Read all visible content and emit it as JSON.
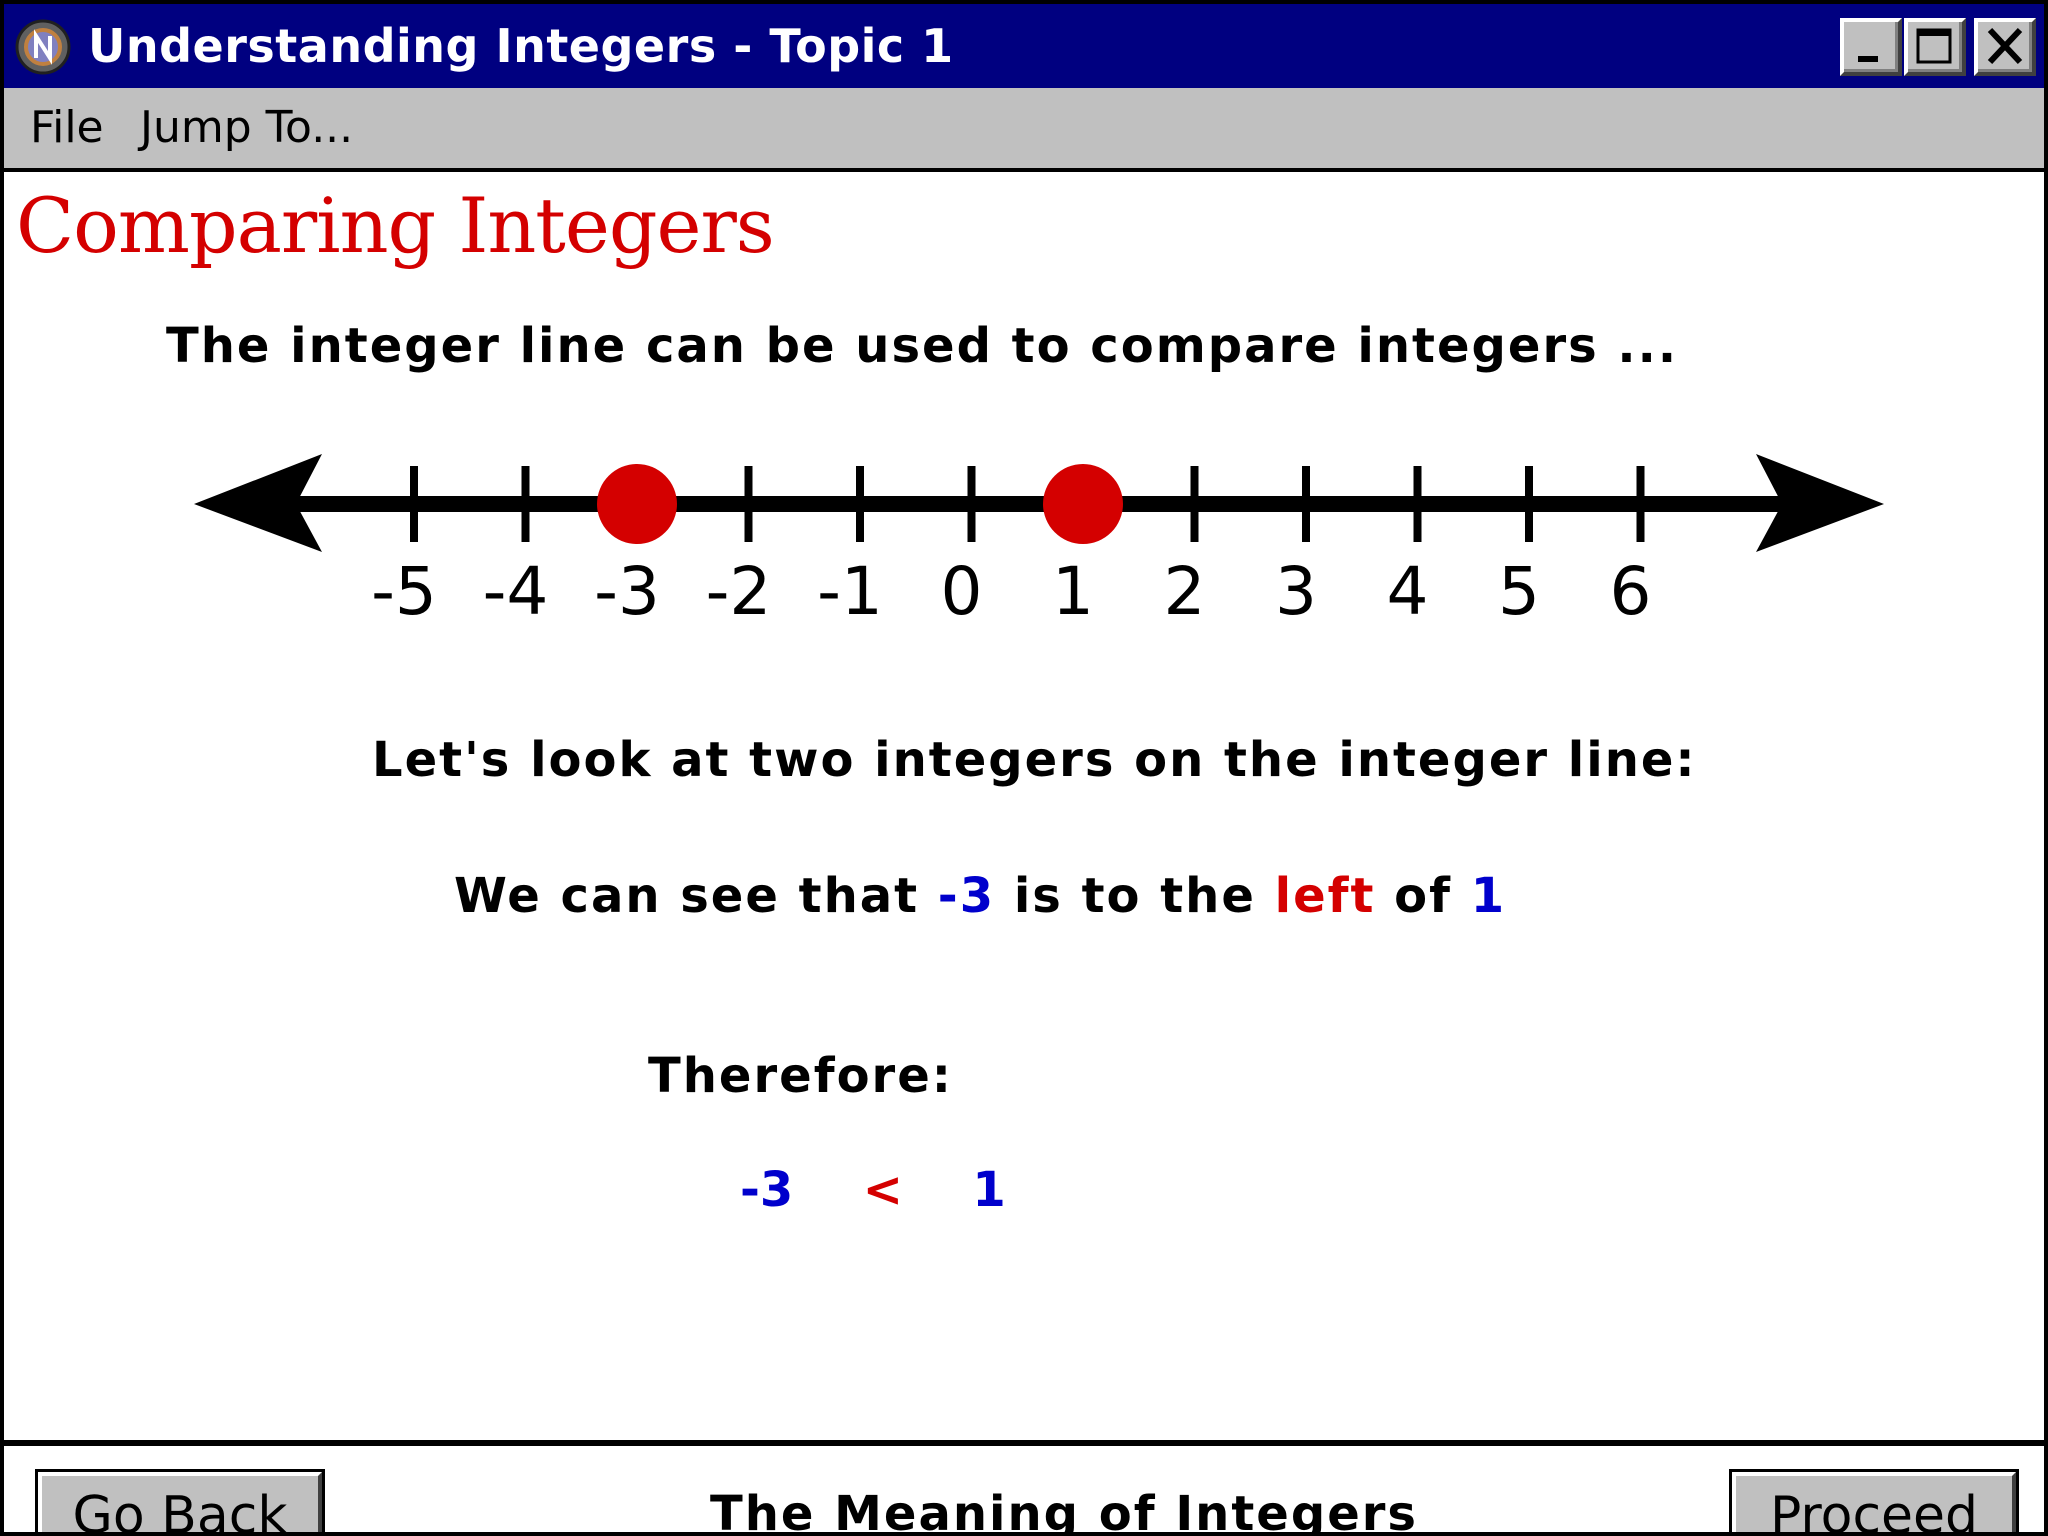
{
  "window": {
    "title": "Understanding Integers - Topic 1",
    "icon": "integers-app-icon",
    "controls": [
      "minimize-icon",
      "maximize-icon",
      "close-icon"
    ]
  },
  "menu": {
    "items": [
      "File",
      "Jump To..."
    ]
  },
  "content": {
    "heading": "Comparing Integers",
    "intro": "The integer line can be used to compare integers ...",
    "look": "Let's look at two integers on the integer line:",
    "see": {
      "prefix": "We can see that",
      "num_a": "-3",
      "middle": "is to the",
      "direction": "left",
      "of": "of",
      "num_b": "1"
    },
    "therefore": "Therefore:",
    "inequality": {
      "left": "-3",
      "op": "<",
      "right": "1"
    }
  },
  "number_line": {
    "ticks": [
      -5,
      -4,
      -3,
      -2,
      -1,
      0,
      1,
      2,
      3,
      4,
      5,
      6
    ],
    "tick_labels": [
      "-5",
      "-4",
      "-3",
      "-2",
      "-1",
      "0",
      "1",
      "2",
      "3",
      "4",
      "5",
      "6"
    ],
    "highlighted": [
      -3,
      1
    ],
    "highlight_color": "#d40000"
  },
  "footer": {
    "back_label": "Go Back",
    "topic": "The Meaning of Integers",
    "proceed_label": "Proceed"
  },
  "colors": {
    "titlebar": "#000080",
    "heading": "#d40000",
    "emphasis_blue": "#0000cc",
    "emphasis_red": "#d40000"
  }
}
